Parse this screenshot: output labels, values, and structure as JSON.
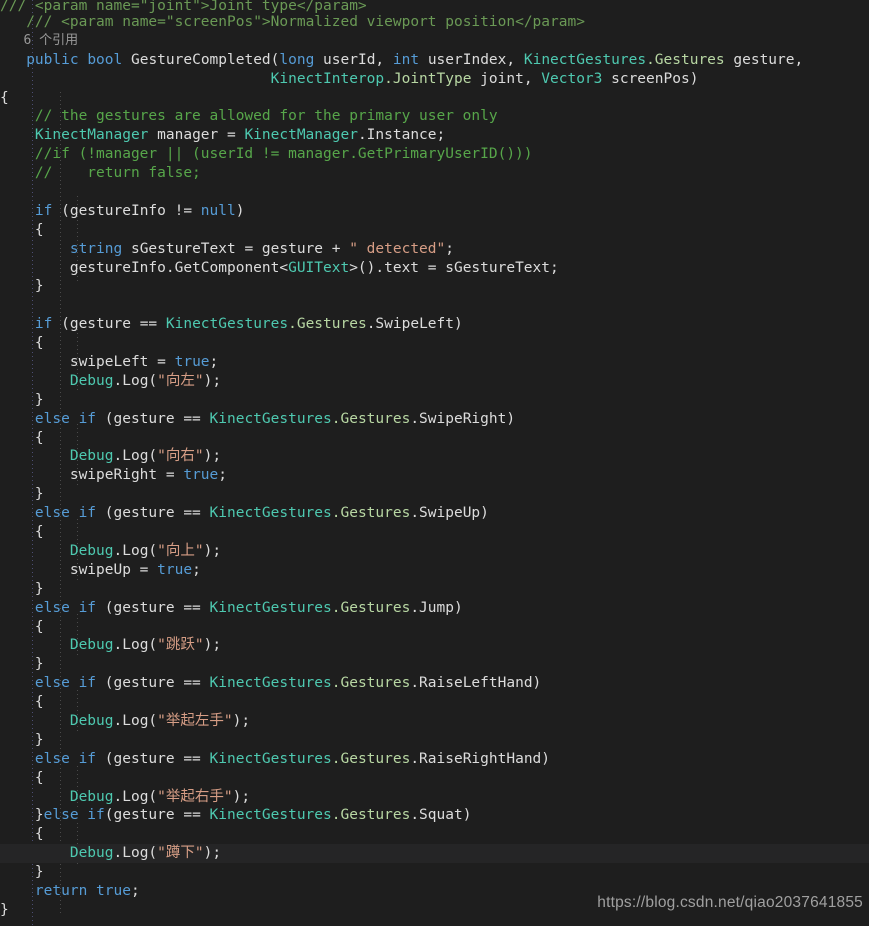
{
  "editor": {
    "background_color": "#1e1e1e",
    "default_text_color": "#d4d4d4",
    "language": "C#",
    "reference_annotation": "6 个引用",
    "current_line_index": 43
  },
  "colors": {
    "comment": "#57a64a",
    "doc_comment": "#6a9955",
    "keyword": "#569cd6",
    "type": "#4ec9b0",
    "enum_member": "#b8d7a3",
    "string": "#d69d85",
    "plain": "#dcdcdc",
    "reference_text": "#9a9a9a",
    "indent_guide": "#4b4e72",
    "current_line": "#252526"
  },
  "code_lines": [
    "/// <param name=\"joint\">Joint type</param>",
    "/// <param name=\"screenPos\">Normalized viewport position</param>",
    "6 个引用",
    "public bool GestureCompleted(long userId, int userIndex, KinectGestures.Gestures gesture,",
    "                            KinectInterop.JointType joint, Vector3 screenPos)",
    "{",
    "    // the gestures are allowed for the primary user only",
    "    KinectManager manager = KinectManager.Instance;",
    "    //if (!manager || (userId != manager.GetPrimaryUserID()))",
    "    //    return false;",
    "",
    "    if (gestureInfo != null)",
    "    {",
    "        string sGestureText = gesture + \" detected\";",
    "        gestureInfo.GetComponent<GUIText>().text = sGestureText;",
    "    }",
    "",
    "    if (gesture == KinectGestures.Gestures.SwipeLeft)",
    "    {",
    "        swipeLeft = true;",
    "        Debug.Log(\"向左\");",
    "    }",
    "    else if (gesture == KinectGestures.Gestures.SwipeRight)",
    "    {",
    "        Debug.Log(\"向右\");",
    "        swipeRight = true;",
    "    }",
    "    else if (gesture == KinectGestures.Gestures.SwipeUp)",
    "    {",
    "        Debug.Log(\"向上\");",
    "        swipeUp = true;",
    "    }",
    "    else if (gesture == KinectGestures.Gestures.Jump)",
    "    {",
    "        Debug.Log(\"跳跃\");",
    "    }",
    "    else if (gesture == KinectGestures.Gestures.RaiseLeftHand)",
    "    {",
    "        Debug.Log(\"举起左手\");",
    "    }",
    "    else if (gesture == KinectGestures.Gestures.RaiseRightHand)",
    "    {",
    "        Debug.Log(\"举起右手\");",
    "    }else if(gesture == KinectGestures.Gestures.Squat)",
    "    {",
    "        Debug.Log(\"蹲下\");",
    "    }",
    "    return true;",
    "}"
  ],
  "tokens": {
    "doc_param_1": "/// <param name=",
    "doc_param_1_name": "\"joint\"",
    "doc_param_1_rest": ">Joint type</param>",
    "doc_param_2": "/// <param name=",
    "doc_param_2_name": "\"screenPos\"",
    "doc_param_2_rest": ">Normalized viewport position</param>",
    "ref_count": "6 个引用",
    "kw_public": "public",
    "kw_bool": "bool",
    "method_name": " GestureCompleted(",
    "kw_long": "long",
    "arg_userid": " userId, ",
    "kw_int": "int",
    "arg_userindex": " userIndex, ",
    "type_kinectgestures": "KinectGestures",
    "enum_gestures": ".Gestures",
    "arg_gesture": " gesture,",
    "type_kinectinterop": "KinectInterop",
    "type_jointtype": ".JointType",
    "arg_joint": " joint, ",
    "type_vector3": "Vector3",
    "arg_screenpos": " screenPos)",
    "brace_open": "{",
    "brace_close": "}",
    "comment_primary_user": "// the gestures are allowed for the primary user only",
    "type_kinectmanager": "KinectManager",
    "var_manager": " manager = ",
    "kinectmanager_instance": ".Instance;",
    "comment_if_manager": "//if (!manager || (userId != manager.GetPrimaryUserID()))",
    "comment_return_false": "//    return false;",
    "kw_if": "if",
    "cond_gestureinfo": " (gestureInfo != ",
    "kw_null": "null",
    "paren_close": ")",
    "kw_string": "string",
    "assign_sgesturetext": " sGestureText = gesture + ",
    "str_detected": "\" detected\"",
    "semicolon": ";",
    "gestureinfo_getcomponent": "gestureInfo.GetComponent<",
    "type_guitext": "GUIText",
    "guitext_text": ">().text = sGestureText;",
    "cond_gesture_eq": " (gesture == ",
    "enum_swipeleft": ".SwipeLeft",
    "enum_swiperight": ".SwipeRight",
    "enum_swipeup": ".SwipeUp",
    "enum_jump": ".Jump",
    "enum_raiselefthand": ".RaiseLeftHand",
    "enum_raiserighthand": ".RaiseRightHand",
    "enum_squat": ".Squat",
    "kw_else": "else",
    "kw_elseif": "else if",
    "assign_swipeleft": "swipeLeft = ",
    "assign_swiperight": "swipeRight = ",
    "assign_swipeup": "swipeUp = ",
    "kw_true": "true",
    "type_debug": "Debug",
    "debug_log_open": ".Log(",
    "str_left": "\"向左\"",
    "str_right": "\"向右\"",
    "str_up": "\"向上\"",
    "str_jump": "\"跳跃\"",
    "str_raise_left": "\"举起左手\"",
    "str_raise_right": "\"举起右手\"",
    "str_squat": "\"蹲下\"",
    "debug_log_close": ");",
    "kw_return": "return",
    "return_true": " true",
    "brace_close_elseif": "}",
    "kw_elseif_tight": "else if",
    "cond_gesture_eq_tight": "(gesture == "
  },
  "watermark": {
    "text": "https://blog.csdn.net/qiao2037641855"
  }
}
